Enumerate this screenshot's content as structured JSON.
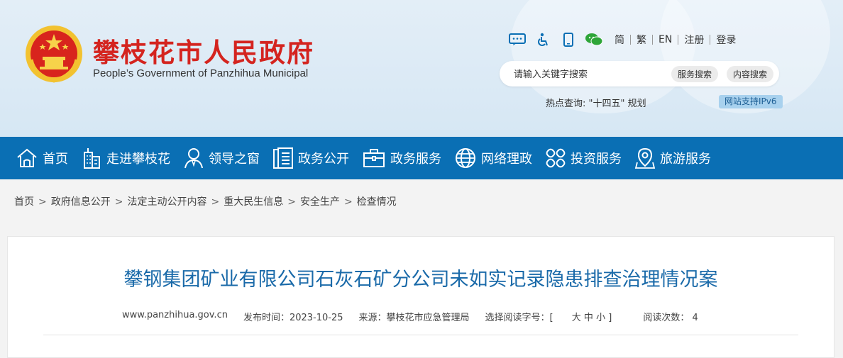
{
  "header": {
    "title_cn": "攀枝花市人民政府",
    "title_en": "People’s Government of Panzhihua Municipal"
  },
  "toolbar": {
    "icons": [
      "message-icon",
      "accessibility-icon",
      "mobile-icon",
      "wechat-icon"
    ],
    "links": [
      "简",
      "繁",
      "EN",
      "注册",
      "登录"
    ]
  },
  "search": {
    "placeholder": "请输入关键字搜索",
    "btn_service": "服务搜索",
    "btn_content": "内容搜索"
  },
  "hot": {
    "label": "热点查询:",
    "link": "\"十四五\" 规划"
  },
  "ipv6": "网站支持IPv6",
  "nav": [
    {
      "label": "首页",
      "icon": "home-icon"
    },
    {
      "label": "走进攀枝花",
      "icon": "city-icon"
    },
    {
      "label": "领导之窗",
      "icon": "person-icon"
    },
    {
      "label": "政务公开",
      "icon": "document-icon"
    },
    {
      "label": "政务服务",
      "icon": "briefcase-icon"
    },
    {
      "label": "网络理政",
      "icon": "globe-icon"
    },
    {
      "label": "投资服务",
      "icon": "invest-icon"
    },
    {
      "label": "旅游服务",
      "icon": "location-icon"
    }
  ],
  "breadcrumb": [
    "首页",
    "政府信息公开",
    "法定主动公开内容",
    "重大民生信息",
    "安全生产",
    "检查情况"
  ],
  "article": {
    "title": "攀钢集团矿业有限公司石灰石矿分公司未如实记录隐患排查治理情况案",
    "site": "www.panzhihua.gov.cn",
    "publish": "发布时间：2023-10-25",
    "source": "来源：攀枝花市应急管理局",
    "fontsize_label": "选择阅读字号：[",
    "size_large": "大",
    "size_mid": "中",
    "size_small": "小",
    "fontsize_end": "]",
    "views": "阅读次数： 4"
  },
  "colors": {
    "nav_bg": "#0a6fb4",
    "title_red": "#d4241f",
    "article_title": "#1a6aa9"
  }
}
